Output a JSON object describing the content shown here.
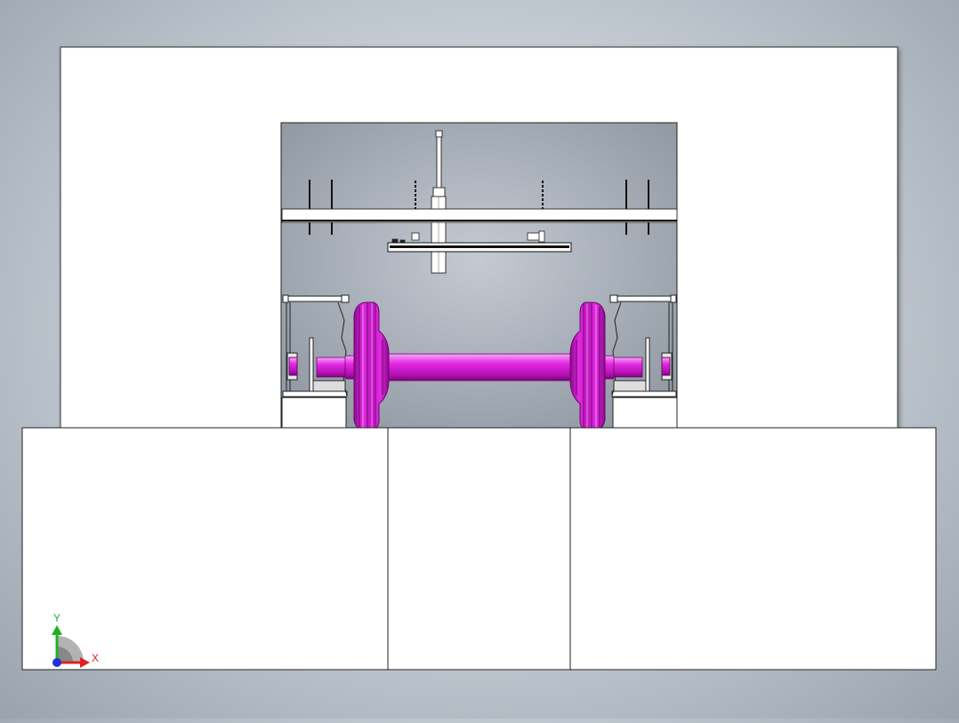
{
  "view": {
    "background_top": "#e8ecf0",
    "background_edge": "#9aa3ad",
    "model_color": "#e01ee0",
    "model_dark": "#8a0a8a",
    "model_light": "#f5a6f5"
  },
  "triad": {
    "x_label": "X",
    "y_label": "Y",
    "x_color": "#e02020",
    "y_color": "#20b020",
    "z_color": "#2030e0"
  }
}
